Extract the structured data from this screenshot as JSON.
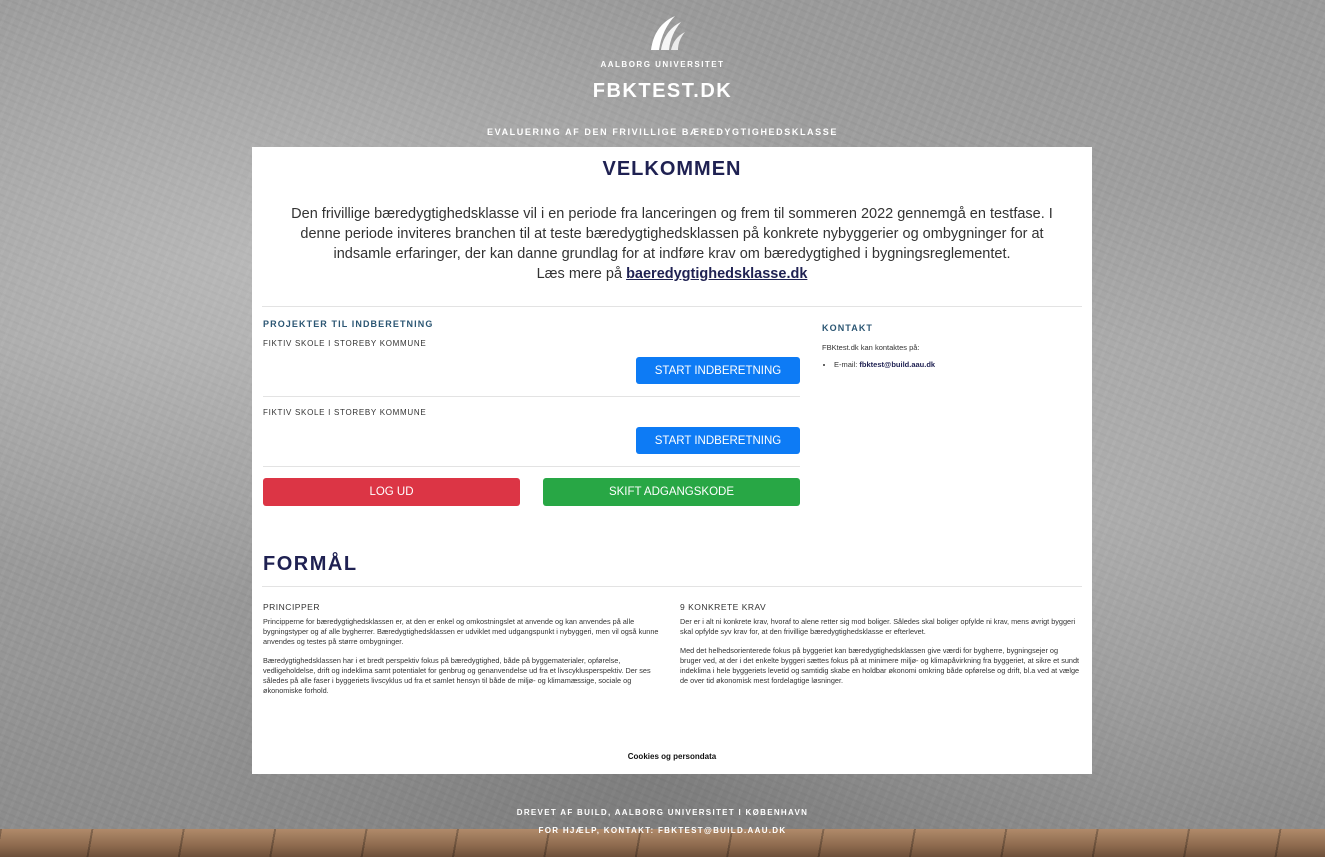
{
  "header": {
    "university": "AALBORG UNIVERSITET",
    "site_title": "FBKTEST.DK",
    "tagline": "EVALUERING AF DEN FRIVILLIGE BÆREDYGTIGHEDSKLASSE"
  },
  "welcome": {
    "title": "VELKOMMEN",
    "intro": "Den frivillige bæredygtighedsklasse vil i en periode fra lanceringen og frem til sommeren 2022 gennemgå en testfase. I denne periode inviteres branchen til at teste bæredygtighedsklassen på konkrete nybyggerier og ombygninger for at indsamle erfaringer, der kan danne grundlag for at indføre krav om bæredygtighed i bygningsreglementet.",
    "read_more_prefix": "Læs mere på ",
    "read_more_link": "baeredygtighedsklasse.dk"
  },
  "projects": {
    "title": "PROJEKTER TIL INDBERETNING",
    "items": [
      {
        "name": "FIKTIV SKOLE I STOREBY KOMMUNE",
        "button": "START INDBERETNING"
      },
      {
        "name": "FIKTIV SKOLE I STOREBY KOMMUNE",
        "button": "START INDBERETNING"
      }
    ],
    "logout": "LOG UD",
    "change_password": "SKIFT ADGANGSKODE"
  },
  "contact": {
    "title": "KONTAKT",
    "text": "FBKtest.dk kan kontaktes på:",
    "email_label": "E-mail: ",
    "email": "fbktest@build.aau.dk"
  },
  "purpose": {
    "title": "FORMÅL",
    "left": {
      "heading": "PRINCIPPER",
      "p1": "Principperne for bæredygtighedsklassen er, at den er enkel og omkostningslet at anvende og kan anvendes på alle bygningstyper og af alle bygherrer. Bæredygtighedsklassen er udviklet med udgangspunkt i nybyggeri, men vil også kunne anvendes og testes på større ombygninger.",
      "p2": "Bæredygtighedsklassen har i et bredt perspektiv fokus på bæredygtighed, både på byggematerialer, opførelse, vedligeholdelse, drift og indeklima samt potentialet for genbrug og genanvendelse ud fra et livscyklusperspektiv. Der ses således på alle faser i byggeriets livscyklus ud fra et samlet hensyn til både de miljø- og klimamæssige, sociale og økonomiske forhold."
    },
    "right": {
      "heading": "9 KONKRETE KRAV",
      "p1": "Der er i alt ni konkrete krav, hvoraf to alene retter sig mod boliger. Således skal boliger opfylde ni krav, mens øvrigt byggeri skal opfylde syv krav for, at den frivillige bæredygtighedsklasse er efterlevet.",
      "p2": "Med det helhedsorienterede fokus på byggeriet kan bæredygtighedsklassen give værdi for bygherre, bygningsejer og bruger ved, at der i det enkelte byggeri sættes fokus på at minimere miljø- og klimapåvirkning fra byggeriet, at sikre et sundt indeklima i hele byggeriets levetid og samtidig skabe en holdbar økonomi omkring både opførelse og drift, bl.a ved at vælge de over tid økonomisk mest fordelagtige løsninger."
    }
  },
  "cookies": "Cookies og persondata",
  "footer": {
    "line1": "DREVET AF BUILD, AALBORG UNIVERSITET I KØBENHAVN",
    "line2": "FOR HJÆLP, KONTAKT: FBKTEST@BUILD.AAU.DK"
  }
}
